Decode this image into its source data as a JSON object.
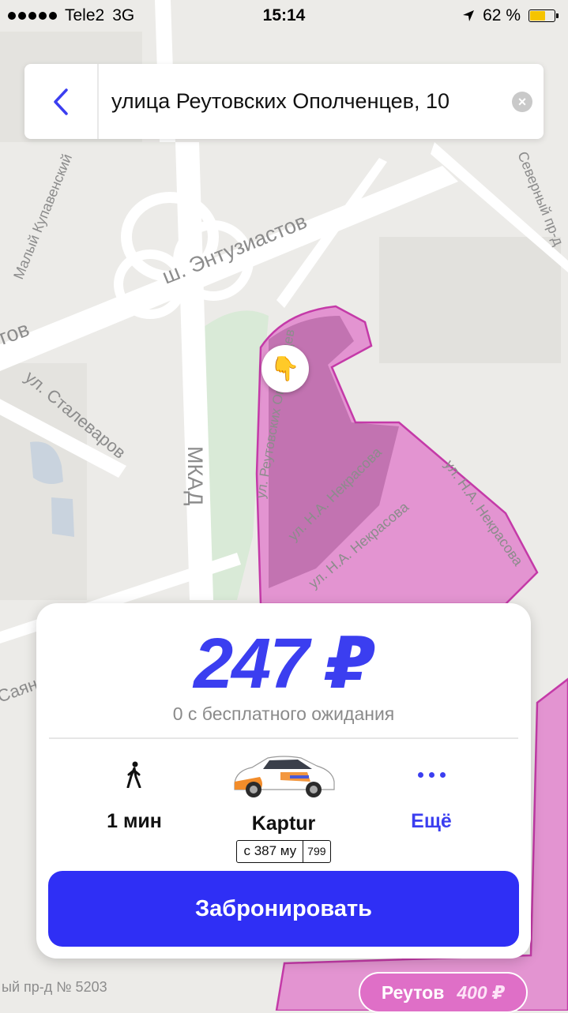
{
  "status_bar": {
    "carrier": "Tele2",
    "network": "3G",
    "time": "15:14",
    "battery": "62 %",
    "battery_level": 0.62
  },
  "search": {
    "address": "улица Реутовских Ополченцев, 10"
  },
  "map": {
    "labels": {
      "entuziastov": "ш. Энтузиастов",
      "mkad": "МКАД",
      "stalevarov": "ул. Сталеваров",
      "kupavensky": "Малый Купавенский",
      "severny": "Северный пр-д",
      "reutovskih": "ул. Реутовских Ополченцев",
      "nekrasova": "ул. Н.А. Некрасова",
      "tov_left": "тов",
      "sayan": "Саян",
      "proezd": "ый пр-д № 5203"
    },
    "pin_icon": "pointing-hand-icon",
    "zone_color": "#df6fc7"
  },
  "card": {
    "price": "247 ₽",
    "wait_text": "0 с бесплатного ожидания",
    "walk": {
      "icon": "walking-person-icon",
      "label": "1 мин"
    },
    "car": {
      "name": "Kaptur",
      "plate_main": "с 387 му",
      "plate_region": "799"
    },
    "more": {
      "label": "Ещё"
    },
    "book_button": "Забронировать"
  },
  "zone_badge": {
    "name": "Реутов",
    "price": "400 ₽"
  },
  "colors": {
    "accent": "#3b3ef0",
    "button": "#2f2ff5",
    "zone": "#df6fc7"
  }
}
